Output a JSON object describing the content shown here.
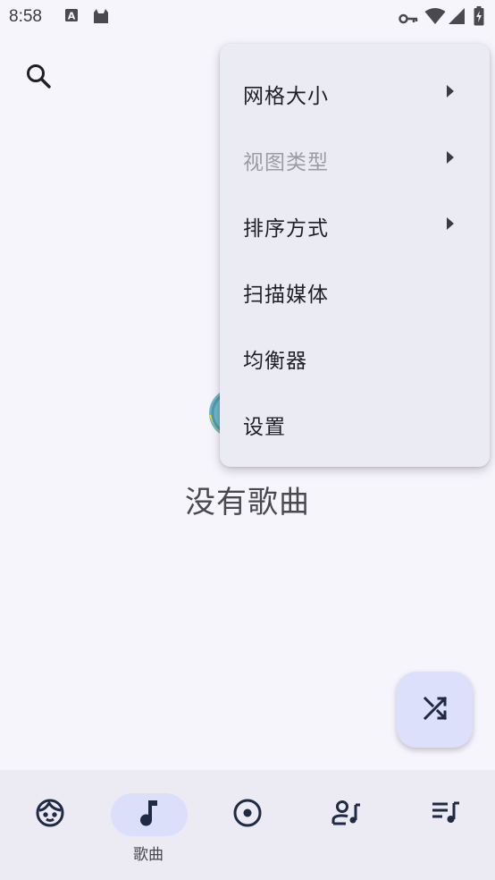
{
  "status_bar": {
    "time": "8:58",
    "left_icons": [
      "a-box-icon",
      "cat-icon"
    ],
    "right_icons": [
      "vpn-key-icon",
      "wifi-icon",
      "signal-icon",
      "battery-charging-icon"
    ]
  },
  "toolbar": {
    "search_icon": "search-icon"
  },
  "menu": {
    "items": [
      {
        "label": "网格大小",
        "has_submenu": true,
        "enabled": true
      },
      {
        "label": "视图类型",
        "has_submenu": true,
        "enabled": false
      },
      {
        "label": "排序方式",
        "has_submenu": true,
        "enabled": true
      },
      {
        "label": "扫描媒体",
        "has_submenu": false,
        "enabled": true
      },
      {
        "label": "均衡器",
        "has_submenu": false,
        "enabled": true
      },
      {
        "label": "设置",
        "has_submenu": false,
        "enabled": true
      }
    ]
  },
  "empty_state": {
    "text": "没有歌曲"
  },
  "fab": {
    "icon": "shuffle-icon"
  },
  "bottom_nav": {
    "items": [
      {
        "icon": "face-icon",
        "label": "",
        "active": false
      },
      {
        "icon": "music-note-icon",
        "label": "歌曲",
        "active": true
      },
      {
        "icon": "album-icon",
        "label": "",
        "active": false
      },
      {
        "icon": "artist-icon",
        "label": "",
        "active": false
      },
      {
        "icon": "playlist-icon",
        "label": "",
        "active": false
      }
    ]
  },
  "colors": {
    "background": "#f7f5fc",
    "menu_background": "#ebebf4",
    "fab_background": "#dde0fb",
    "nav_background": "#ecebf3",
    "active_pill": "#dcdffa",
    "icon_dark": "#1f2a44"
  }
}
